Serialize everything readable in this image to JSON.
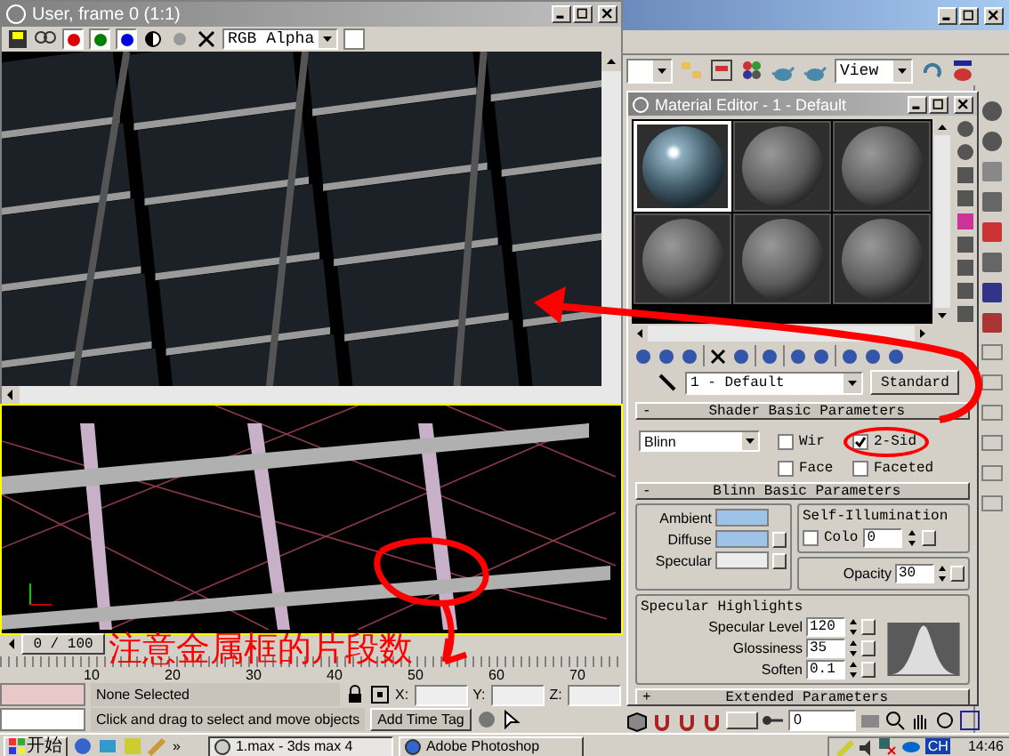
{
  "render_window": {
    "title": "User, frame 0 (1:1)",
    "channels": [
      {
        "kind": "red",
        "on": true
      },
      {
        "kind": "green",
        "on": true
      },
      {
        "kind": "blue",
        "on": true
      }
    ],
    "channel_dropdown": "RGB Alpha"
  },
  "main_toolbar": {
    "view_dropdown": "View"
  },
  "material_editor": {
    "title": "Material Editor - 1 - Default",
    "slots": [
      {
        "selected": true
      },
      {
        "selected": false
      },
      {
        "selected": false
      },
      {
        "selected": false
      },
      {
        "selected": false
      },
      {
        "selected": false
      }
    ],
    "material_name": "1 - Default",
    "material_type": "Standard",
    "shader_rollout": {
      "toggle": "-",
      "title": "Shader Basic Parameters",
      "shader": "Blinn",
      "options": [
        {
          "label": "Wir",
          "checked": false,
          "circled": false
        },
        {
          "label": "2-Sid",
          "checked": true,
          "circled": true
        },
        {
          "label": "Face",
          "checked": false,
          "circled": false
        },
        {
          "label": "Faceted",
          "checked": false,
          "circled": false
        }
      ]
    },
    "blinn_rollout": {
      "toggle": "-",
      "title": "Blinn Basic Parameters",
      "colors": [
        {
          "label": "Ambient",
          "color": "#9ec3e8"
        },
        {
          "label": "Diffuse",
          "color": "#9ec3e8"
        },
        {
          "label": "Specular",
          "color": "#ececec"
        }
      ],
      "self_illumination": {
        "title": "Self-Illumination",
        "label": "Colo",
        "checked": false,
        "value": "0"
      },
      "opacity": {
        "label": "Opacity",
        "value": "30"
      },
      "highlights": {
        "title": "Specular Highlights",
        "fields": [
          {
            "label": "Specular Level",
            "value": "120"
          },
          {
            "label": "Glossiness",
            "value": "35"
          },
          {
            "label": "Soften",
            "value": "0.1"
          }
        ]
      }
    },
    "extended_rollout": {
      "toggle": "+",
      "title": "Extended Parameters"
    }
  },
  "timeline": {
    "frame": "0 / 100",
    "ticks": [
      "10",
      "20",
      "30",
      "40",
      "50",
      "60",
      "70"
    ]
  },
  "status": {
    "selection": "None Selected",
    "coords": [
      "X:",
      "Y:",
      "Z:"
    ],
    "prompt": "Click and drag to select and move objects",
    "time_tag": "Add Time Tag",
    "key_value": "0"
  },
  "taskbar": {
    "start": "开始",
    "chevron": "»",
    "tasks": [
      {
        "label": "1.max - 3ds max 4",
        "selected": true
      },
      {
        "label": "Adobe Photoshop",
        "selected": false
      }
    ],
    "language": "CH",
    "clock": "14:46"
  },
  "annotation": {
    "note": "注意金属框的片段数"
  }
}
